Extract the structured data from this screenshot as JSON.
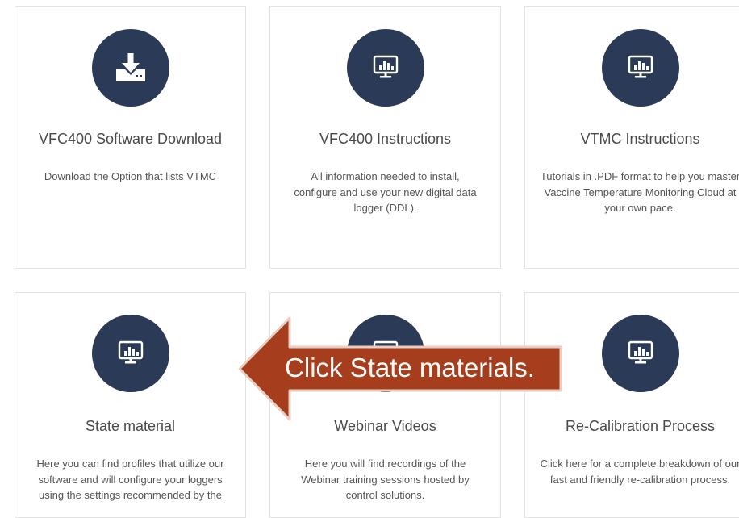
{
  "cards": [
    {
      "title": "VFC400 Software Download",
      "description": "Download the Option that lists VTMC",
      "icon": "download-icon"
    },
    {
      "title": "VFC400 Instructions",
      "description": "All information needed to install, configure and use your new digital data logger (DDL).",
      "icon": "monitor-chart-icon"
    },
    {
      "title": "VTMC Instructions",
      "description": "Tutorials in .PDF format to help you master Vaccine Temperature Monitoring Cloud at your own pace.",
      "icon": "monitor-chart-icon"
    },
    {
      "title": "State material",
      "description": "Here you can find profiles that utilize our software and will configure your loggers using the settings recommended by the",
      "icon": "monitor-chart-icon"
    },
    {
      "title": "Webinar Videos",
      "description": "Here you will find recordings of the Webinar training sessions hosted by control solutions.",
      "icon": "monitor-chart-icon"
    },
    {
      "title": "Re-Calibration Process",
      "description": "Click here for a complete breakdown of our fast and friendly re-calibration process.",
      "icon": "monitor-chart-icon"
    }
  ],
  "callout": {
    "text": "Click State materials."
  },
  "colors": {
    "icon_circle": "#2b3a56",
    "arrow_fill": "#a63d1c",
    "arrow_border": "#e8cfc3",
    "text_title": "#4a4a4a",
    "text_body": "#555555"
  }
}
